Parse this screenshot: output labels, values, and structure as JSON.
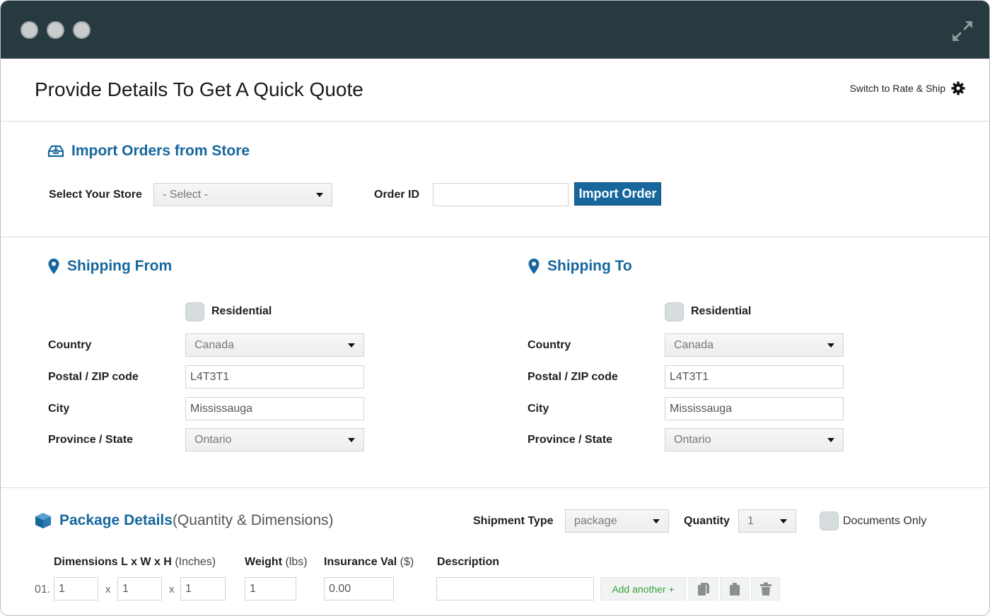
{
  "page": {
    "title": "Provide Details To Get A Quick Quote",
    "switch_label": "Switch to Rate & Ship"
  },
  "import": {
    "title": "Import Orders from Store",
    "store_label": "Select Your Store",
    "store_value": "- Select -",
    "order_id_label": "Order ID",
    "order_id_value": "",
    "import_button": "Import Order"
  },
  "shipping_from": {
    "title": "Shipping From",
    "residential_label": "Residential",
    "country_label": "Country",
    "country_value": "Canada",
    "postal_label": "Postal / ZIP code",
    "postal_value": "L4T3T1",
    "city_label": "City",
    "city_value": "Mississauga",
    "province_label": "Province / State",
    "province_value": "Ontario"
  },
  "shipping_to": {
    "title": "Shipping To",
    "residential_label": "Residential",
    "country_label": "Country",
    "country_value": "Canada",
    "postal_label": "Postal / ZIP code",
    "postal_value": "L4T3T1",
    "city_label": "City",
    "city_value": "Mississauga",
    "province_label": "Province / State",
    "province_value": "Ontario"
  },
  "package": {
    "title": "Package Details",
    "subtitle": "(Quantity & Dimensions)",
    "shipment_type_label": "Shipment Type",
    "shipment_type_value": "package",
    "quantity_label": "Quantity",
    "quantity_value": "1",
    "documents_only_label": "Documents Only",
    "dimensions_label": "Dimensions L x W x H",
    "dimensions_unit": "(Inches)",
    "weight_label": "Weight",
    "weight_unit": "(lbs)",
    "insurance_label": "Insurance Val",
    "insurance_unit": "($)",
    "description_label": "Description",
    "row": {
      "number": "01.",
      "length": "1",
      "width": "1",
      "height": "1",
      "weight": "1",
      "insurance": "0.00",
      "description": "",
      "x_sep": "x"
    },
    "add_another_label": "Add another +"
  },
  "colors": {
    "titlebar": "#263a3f",
    "accent": "#17679d",
    "add_green": "#3aa33c"
  }
}
